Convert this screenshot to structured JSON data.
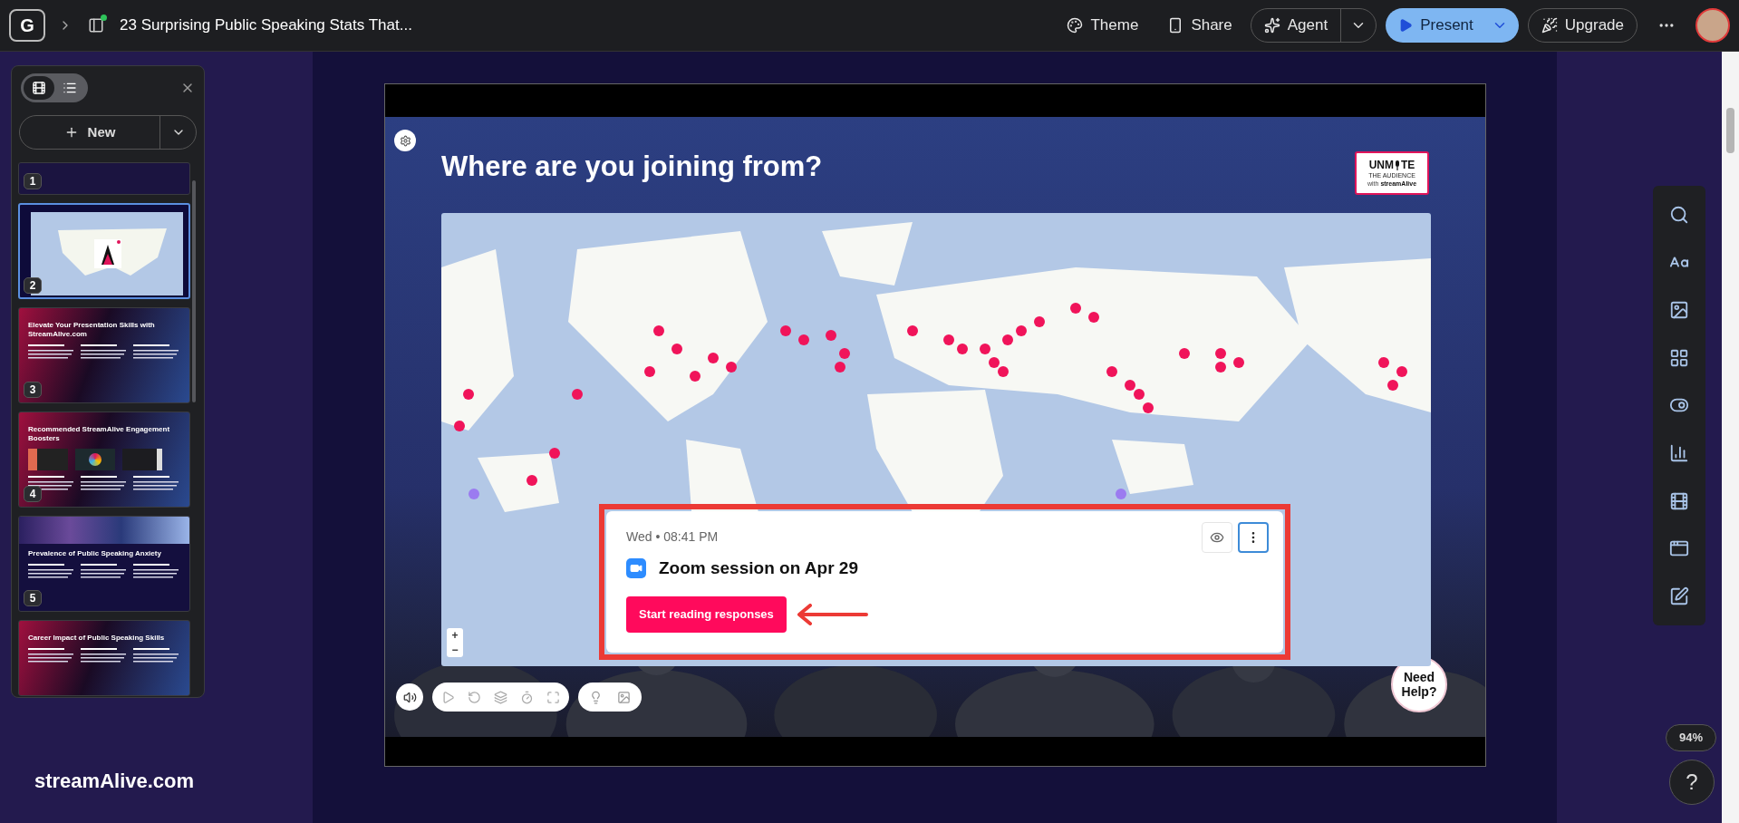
{
  "topbar": {
    "logo": "G",
    "title": "23 Surprising Public Speaking Stats That...",
    "actions": [
      {
        "kind": "theme",
        "label": "Theme"
      },
      {
        "kind": "share",
        "label": "Share"
      }
    ],
    "agent": "Agent",
    "present": "Present",
    "upgrade": "Upgrade"
  },
  "panel": {
    "views": [
      {
        "kind": "filmstrip",
        "selected": true
      },
      {
        "kind": "list",
        "selected": false
      }
    ],
    "new_button": "New",
    "slides": [
      {
        "number": "1",
        "selected": false
      },
      {
        "number": "2",
        "kind": "map",
        "selected": true
      },
      {
        "number": "3",
        "kind": "columns",
        "title": "Elevate Your Presentation Skills with StreamAlive.com",
        "selected": false
      },
      {
        "number": "4",
        "kind": "screens",
        "title": "Recommended StreamAlive Engagement Boosters",
        "selected": false
      },
      {
        "number": "5",
        "kind": "banner",
        "title": "Prevalence of Public Speaking Anxiety",
        "selected": false
      },
      {
        "kind": "columns",
        "title": "Career Impact of Public Speaking Skills",
        "selected": false
      }
    ]
  },
  "brand": "streamAlive.com",
  "slide": {
    "title": "Where are you joining from?",
    "badge": {
      "word_start": "UNM",
      "word_end": "TE",
      "line2": "THE AUDIENCE",
      "with": "with",
      "brand": "streamAlive"
    },
    "map_zoom": [
      "+",
      "−"
    ],
    "card": {
      "time": "Wed • 08:41 PM",
      "session": "Zoom session on Apr 29",
      "button": "Start reading responses"
    },
    "help": "Need Help?"
  },
  "zoom_level": "94%",
  "help_button": "?"
}
